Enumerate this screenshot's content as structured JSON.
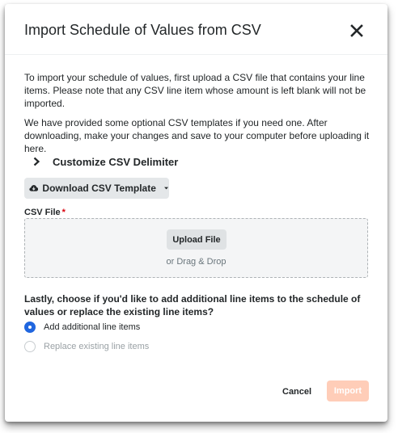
{
  "modal": {
    "title": "Import Schedule of Values from CSV",
    "close_icon": "close-icon"
  },
  "intro": {
    "paragraph1": "To import your schedule of values, first upload a CSV file that contains your line items. Please note that any CSV line item whose amount is left blank will not be imported.",
    "paragraph2": "We have provided some optional CSV templates if you need one. After downloading, make your changes and save to your computer before uploading it here."
  },
  "customize": {
    "label": "Customize CSV Delimiter",
    "icon": "chevron-right-icon"
  },
  "download": {
    "label": "Download CSV Template",
    "icon": "cloud-download-icon",
    "caret_icon": "caret-down-icon"
  },
  "csv_file": {
    "label": "CSV File",
    "required_marker": "*",
    "upload_label": "Upload File",
    "drag_text": "or Drag & Drop"
  },
  "line_items": {
    "question": "Lastly, choose if you'd like to add additional line items to the schedule of values or replace the existing line items?",
    "options": [
      {
        "label": "Add additional line items",
        "selected": true,
        "enabled": true
      },
      {
        "label": "Replace existing line items",
        "selected": false,
        "enabled": false
      }
    ]
  },
  "footer": {
    "cancel_label": "Cancel",
    "import_label": "Import",
    "import_enabled": false
  },
  "colors": {
    "accent": "#2066df",
    "import_disabled": "#ffcdb8",
    "required": "#d8000c",
    "text": "#232729",
    "muted": "#6a767c"
  }
}
